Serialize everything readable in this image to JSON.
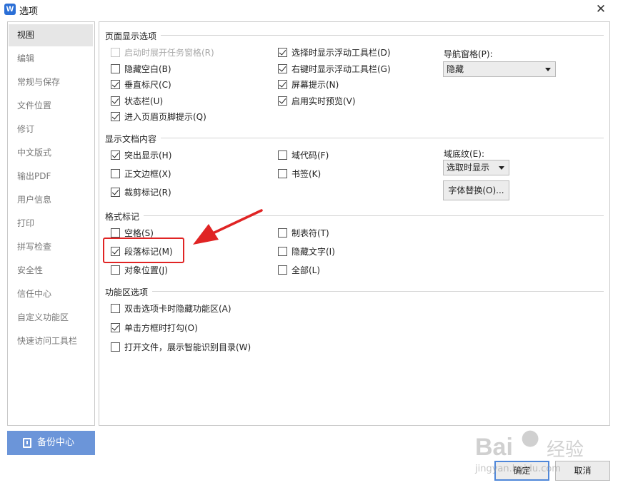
{
  "window": {
    "title": "选项",
    "app_icon": "W"
  },
  "sidebar": {
    "items": [
      {
        "label": "视图",
        "active": true
      },
      {
        "label": "编辑"
      },
      {
        "label": "常规与保存"
      },
      {
        "label": "文件位置"
      },
      {
        "label": "修订"
      },
      {
        "label": "中文版式"
      },
      {
        "label": "输出PDF"
      },
      {
        "label": "用户信息"
      },
      {
        "label": "打印"
      },
      {
        "label": "拼写检查"
      },
      {
        "label": "安全性"
      },
      {
        "label": "信任中心"
      },
      {
        "label": "自定义功能区"
      },
      {
        "label": "快速访问工具栏"
      }
    ],
    "backup_label": "备份中心"
  },
  "sections": {
    "page_display": {
      "title": "页面显示选项",
      "options": [
        {
          "label": "启动时展开任务窗格(R)",
          "checked": false,
          "disabled": true
        },
        {
          "label": "隐藏空白(B)",
          "checked": false
        },
        {
          "label": "垂直标尺(C)",
          "checked": true
        },
        {
          "label": "状态栏(U)",
          "checked": true
        },
        {
          "label": "进入页眉页脚提示(Q)",
          "checked": true
        },
        {
          "label": "选择时显示浮动工具栏(D)",
          "checked": true
        },
        {
          "label": "右键时显示浮动工具栏(G)",
          "checked": true
        },
        {
          "label": "屏幕提示(N)",
          "checked": true
        },
        {
          "label": "启用实时预览(V)",
          "checked": true
        }
      ],
      "nav_label": "导航窗格(P):",
      "nav_value": "隐藏"
    },
    "doc_content": {
      "title": "显示文档内容",
      "options": [
        {
          "label": "突出显示(H)",
          "checked": true
        },
        {
          "label": "正文边框(X)",
          "checked": false
        },
        {
          "label": "裁剪标记(R)",
          "checked": true
        },
        {
          "label": "域代码(F)",
          "checked": false
        },
        {
          "label": "书签(K)",
          "checked": false
        }
      ],
      "shading_label": "域底纹(E):",
      "shading_value": "选取时显示",
      "font_replace_label": "字体替换(O)..."
    },
    "format_marks": {
      "title": "格式标记",
      "options": [
        {
          "label": "空格(S)",
          "checked": false
        },
        {
          "label": "段落标记(M)",
          "checked": true
        },
        {
          "label": "对象位置(J)",
          "checked": false
        },
        {
          "label": "制表符(T)",
          "checked": false
        },
        {
          "label": "隐藏文字(I)",
          "checked": false
        },
        {
          "label": "全部(L)",
          "checked": false
        }
      ]
    },
    "ribbon": {
      "title": "功能区选项",
      "options": [
        {
          "label": "双击选项卡时隐藏功能区(A)",
          "checked": false
        },
        {
          "label": "单击方框时打勾(O)",
          "checked": true
        },
        {
          "label": "打开文件，展示智能识别目录(W)",
          "checked": false
        }
      ]
    }
  },
  "footer": {
    "ok_label": "确定",
    "cancel_label": "取消"
  },
  "watermark": {
    "brand": "Bai",
    "brand2": "经验",
    "url": "jingyan.baidu.com"
  },
  "colors": {
    "accent": "#4f87d9",
    "backup": "#6b95d9",
    "annotation": "#e02424"
  },
  "icons": {
    "close": "close-icon",
    "backup": "backup-icon",
    "dropdown": "chevron-down-icon",
    "annotation": "arrow-annotation"
  }
}
